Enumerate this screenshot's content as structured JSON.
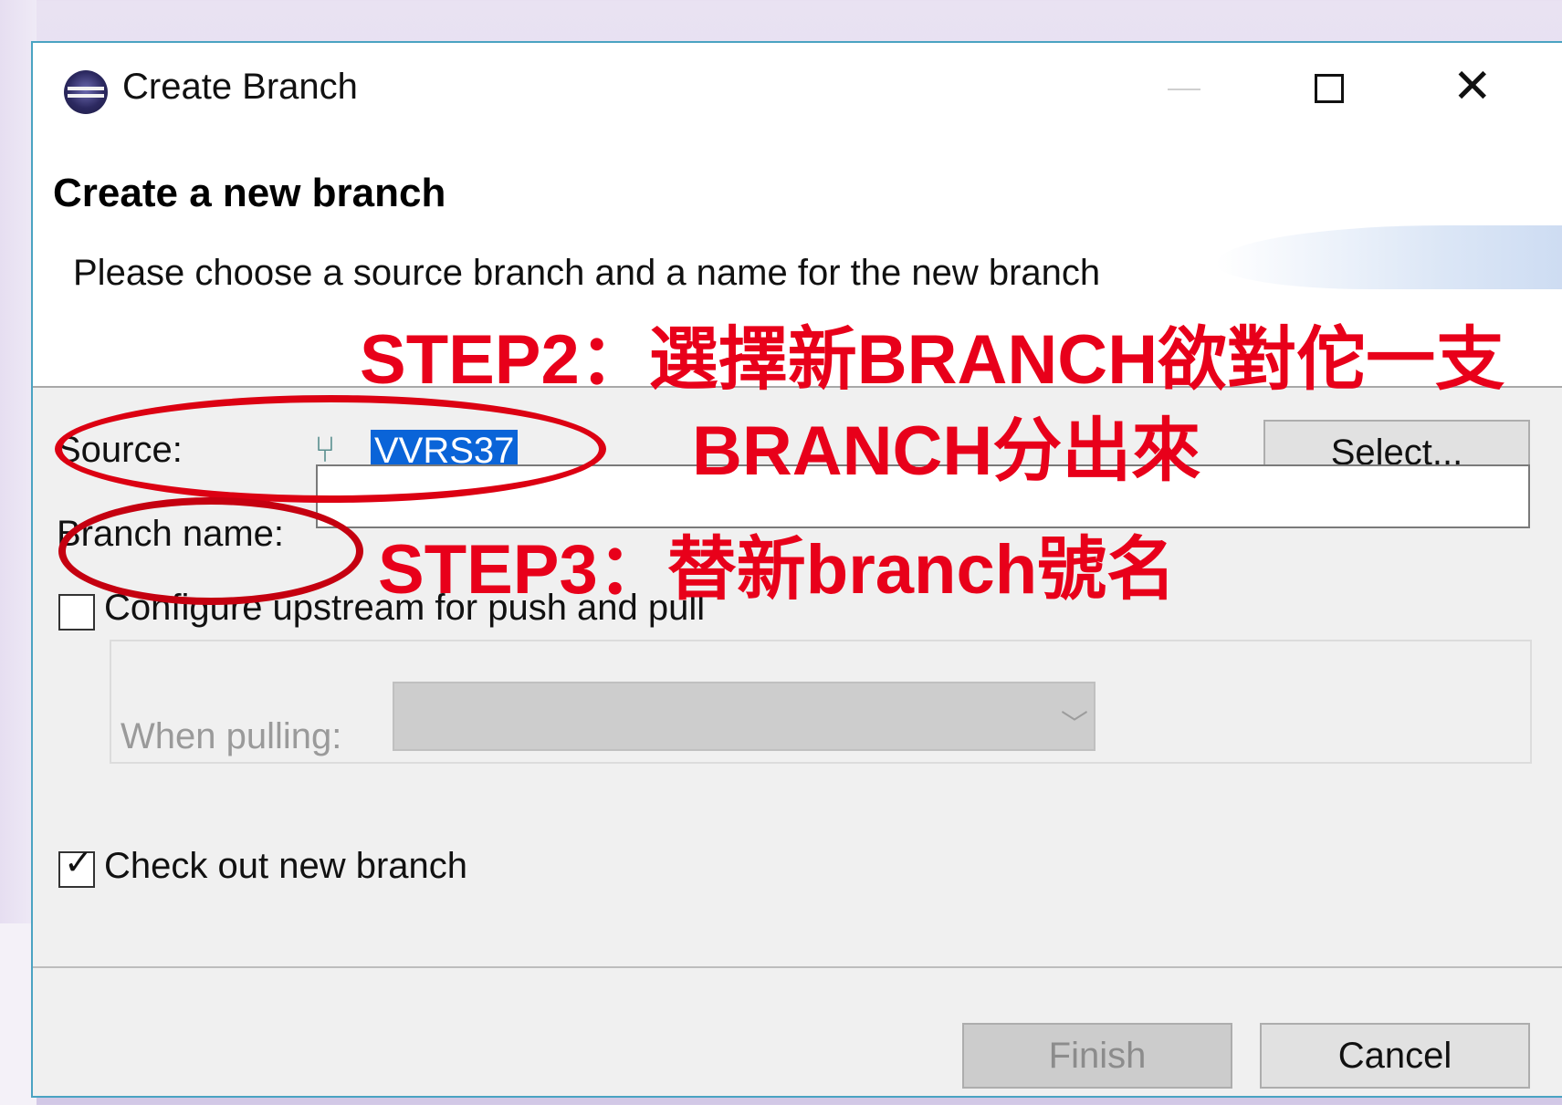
{
  "dialog": {
    "window_title": "Create Branch",
    "header_title": "Create a new branch",
    "header_description": "Please choose a source branch and a name for the new branch"
  },
  "form": {
    "source_label": "Source:",
    "source_value": "VVRS37",
    "select_button": "Select...",
    "branch_name_label": "Branch name:",
    "branch_name_value": "",
    "configure_upstream_label": "Configure upstream for push and pull",
    "when_pulling_label": "When pulling:",
    "when_pulling_value": "",
    "checkout_label": "Check out new branch",
    "checkout_checked": true
  },
  "buttons": {
    "finish": "Finish",
    "cancel": "Cancel"
  },
  "annotations": {
    "step2_line1": "STEP2：選擇新BRANCH欲對佗一支",
    "step2_line2": "BRANCH分出來",
    "step3": "STEP3：替新branch號名"
  },
  "colors": {
    "annotation_red": "#e8001a",
    "selection_blue": "#0a64d8",
    "dialog_border": "#4aa3c2"
  }
}
